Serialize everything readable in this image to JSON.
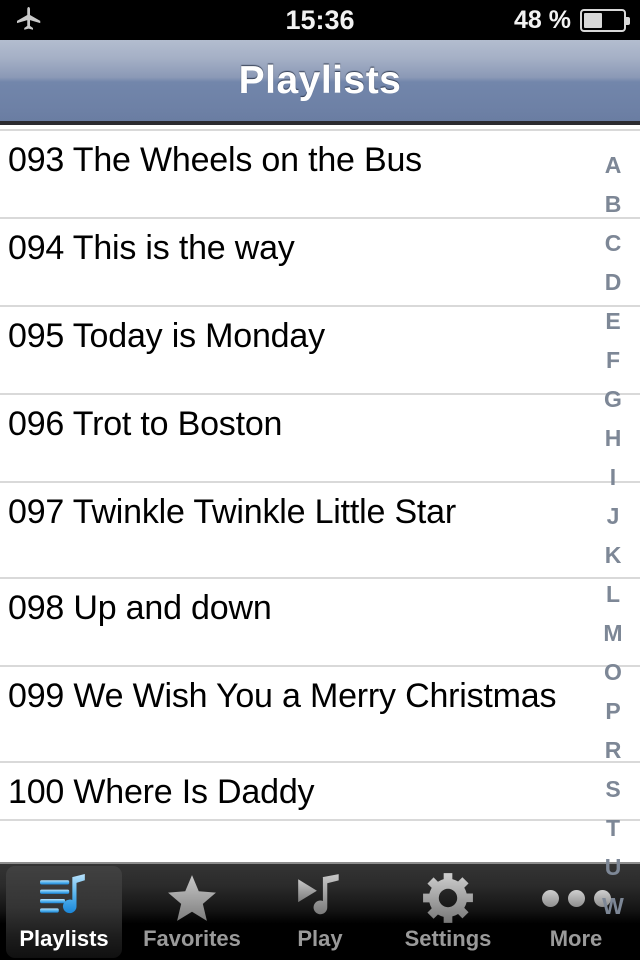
{
  "status_bar": {
    "airplane_icon": "airplane-icon",
    "time": "15:36",
    "battery_percent": "48 %",
    "battery_level": 48,
    "battery_icon": "battery-icon"
  },
  "nav_bar": {
    "title": "Playlists"
  },
  "list": {
    "rows": [
      {
        "label": "093 The Wheels on the Bus"
      },
      {
        "label": "094 This is the way"
      },
      {
        "label": "095 Today is Monday"
      },
      {
        "label": "096 Trot to Boston"
      },
      {
        "label": "097 Twinkle Twinkle Little Star"
      },
      {
        "label": "098 Up and down"
      },
      {
        "label": "099 We Wish You a Merry Christmas"
      },
      {
        "label": "100 Where Is Daddy"
      }
    ]
  },
  "index_bar": {
    "letters": [
      "A",
      "B",
      "C",
      "D",
      "E",
      "F",
      "G",
      "H",
      "I",
      "J",
      "K",
      "L",
      "M",
      "O",
      "P",
      "R",
      "S",
      "T",
      "U",
      "W"
    ]
  },
  "tab_bar": {
    "items": [
      {
        "label": "Playlists",
        "icon": "playlist-note-icon",
        "active": true
      },
      {
        "label": "Favorites",
        "icon": "star-icon",
        "active": false
      },
      {
        "label": "Play",
        "icon": "play-note-icon",
        "active": false
      },
      {
        "label": "Settings",
        "icon": "gear-icon",
        "active": false
      },
      {
        "label": "More",
        "icon": "ellipsis-icon",
        "active": false
      }
    ]
  },
  "colors": {
    "accent_blue": "#3aa0e0",
    "nav_top": "#b3bdcf",
    "nav_bottom": "#6a7da2",
    "index_text": "#7d8796",
    "separator": "#d9d9d9",
    "tab_inactive_text": "#9a9a9a"
  }
}
